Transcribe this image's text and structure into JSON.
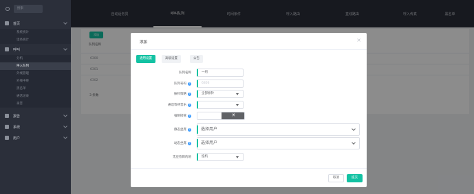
{
  "sidebar": {
    "search_placeholder": "搜索",
    "groups": [
      {
        "label": "首页",
        "icon": "home-icon",
        "items": [
          "系统统计",
          "话务统计"
        ]
      },
      {
        "label": "呼叫",
        "icon": "phone-icon",
        "items": [
          "分机",
          "呼入队列",
          "外线管理",
          "外线中继",
          "黑名单",
          "通话记录",
          "录音"
        ]
      },
      {
        "label": "报告",
        "icon": "chart-icon",
        "items": []
      },
      {
        "label": "系统",
        "icon": "monitor-icon",
        "items": []
      },
      {
        "label": "用户",
        "icon": "gear-icon",
        "items": []
      }
    ]
  },
  "topbar": {
    "tabs": [
      "自动话务员",
      "呼叫队列",
      "时间条件",
      "呼入路由",
      "直线路由",
      "呼入传真",
      "黑名单"
    ],
    "active_index": 1
  },
  "background_page": {
    "add_button": "添加",
    "column_header": "队列名称",
    "rows": [
      "6300",
      "6301",
      "6302"
    ],
    "total_label": "3 条数"
  },
  "modal": {
    "title": "添加",
    "close": "×",
    "tabs": [
      "通用设置",
      "高级设置",
      "公告"
    ],
    "active_tab": 0,
    "fields": {
      "queue_name_label": "队列名称",
      "queue_name_value": "一组",
      "queue_number_label": "队列号码",
      "queue_number_placeholder": "6303",
      "ring_strategy_label": "振铃策略",
      "ring_strategy_value": "全部振铃",
      "moh_label": "通话等待音乐",
      "moh_value": "",
      "takeover_label": "强制接管",
      "takeover_off": "关",
      "static_agents_label": "静态坐席",
      "static_agents_placeholder": "选择用户",
      "dynamic_agents_label": "动态坐席",
      "dynamic_agents_placeholder": "选择用户",
      "no_answer_label": "无应答目的地",
      "no_answer_value": "挂机"
    },
    "cancel_label": "取消",
    "submit_label": "提交"
  },
  "colors": {
    "accent": "#13c2a3",
    "sidebar_bg": "#2b2f3a",
    "help_icon": "#409eff"
  }
}
